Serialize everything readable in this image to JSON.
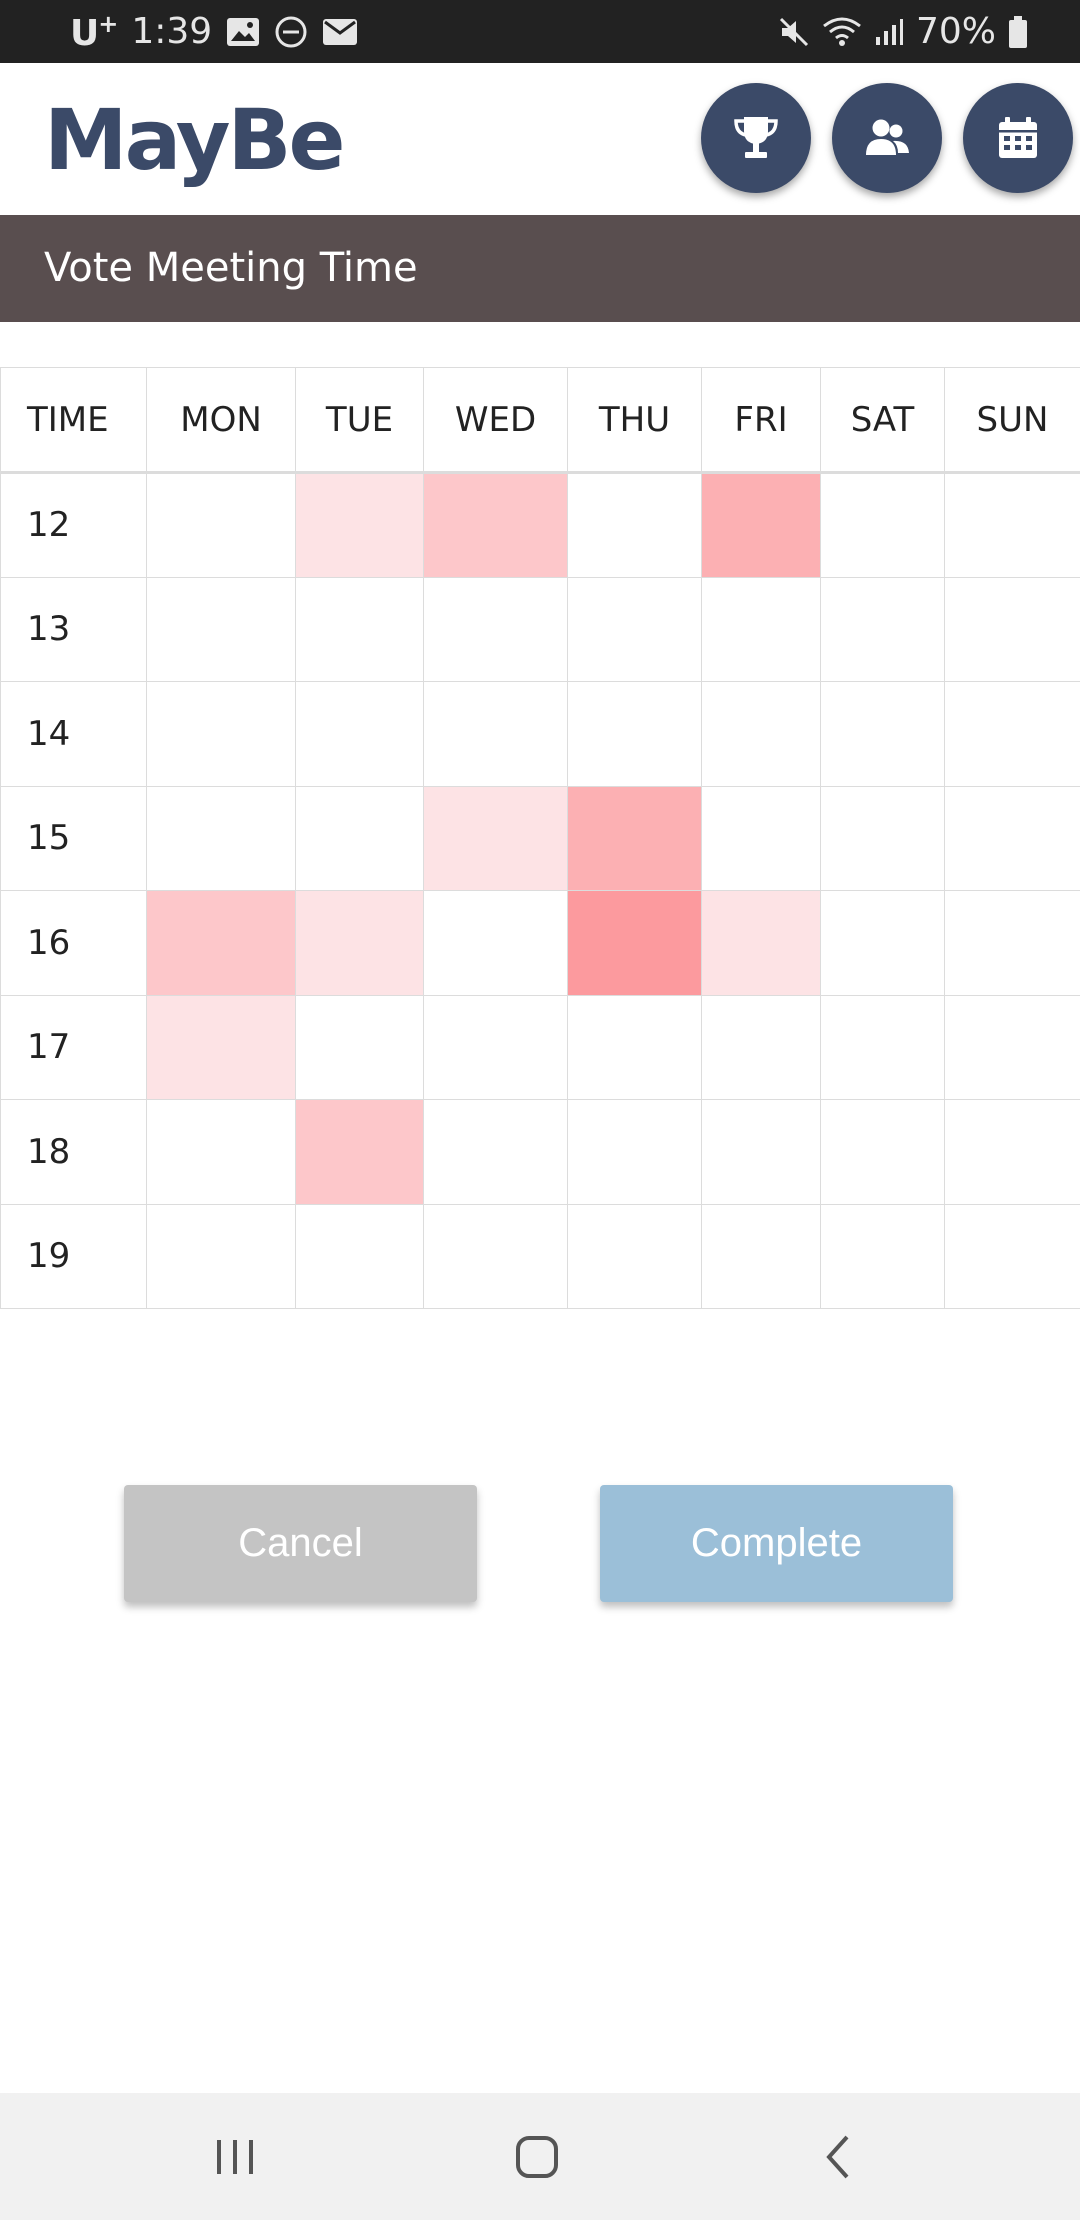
{
  "status_bar": {
    "carrier": "U",
    "carrier_sup": "+",
    "time": "1:39",
    "battery": "70%",
    "left_icons": [
      "image-icon",
      "dnd-icon",
      "mail-icon"
    ],
    "right_icons": [
      "mute-icon",
      "wifi-icon",
      "signal-icon",
      "battery-icon"
    ]
  },
  "header": {
    "logo": "MayBe",
    "buttons": [
      {
        "icon": "trophy-icon"
      },
      {
        "icon": "people-icon"
      },
      {
        "icon": "calendar-icon"
      }
    ]
  },
  "title_bar": {
    "title": "Vote Meeting Time"
  },
  "schedule": {
    "columns": [
      "TIME",
      "MON",
      "TUE",
      "WED",
      "THU",
      "FRI",
      "SAT",
      "SUN"
    ],
    "rows": [
      {
        "hour": "12",
        "votes": [
          0,
          1,
          2,
          0,
          3,
          0,
          0
        ]
      },
      {
        "hour": "13",
        "votes": [
          0,
          0,
          0,
          0,
          0,
          0,
          0
        ]
      },
      {
        "hour": "14",
        "votes": [
          0,
          0,
          0,
          0,
          0,
          0,
          0
        ]
      },
      {
        "hour": "15",
        "votes": [
          0,
          0,
          1,
          3,
          0,
          0,
          0
        ]
      },
      {
        "hour": "16",
        "votes": [
          2,
          1,
          0,
          4,
          1,
          0,
          0
        ]
      },
      {
        "hour": "17",
        "votes": [
          1,
          0,
          0,
          0,
          0,
          0,
          0
        ]
      },
      {
        "hour": "18",
        "votes": [
          0,
          2,
          0,
          0,
          0,
          0,
          0
        ]
      },
      {
        "hour": "19",
        "votes": [
          0,
          0,
          0,
          0,
          0,
          0,
          0
        ]
      }
    ],
    "level_colors": [
      "#ffffff",
      "#fde3e5",
      "#fdc7ca",
      "#fcb0b3",
      "#fc9a9e"
    ]
  },
  "actions": {
    "cancel_label": "Cancel",
    "complete_label": "Complete"
  },
  "colors": {
    "accent": "#3b4a68",
    "title_bar": "#594e4f",
    "cancel": "#c4c4c4",
    "complete": "#9bbfd8"
  },
  "nav_bar": {
    "icons": [
      "recents-icon",
      "home-icon",
      "back-icon"
    ]
  }
}
